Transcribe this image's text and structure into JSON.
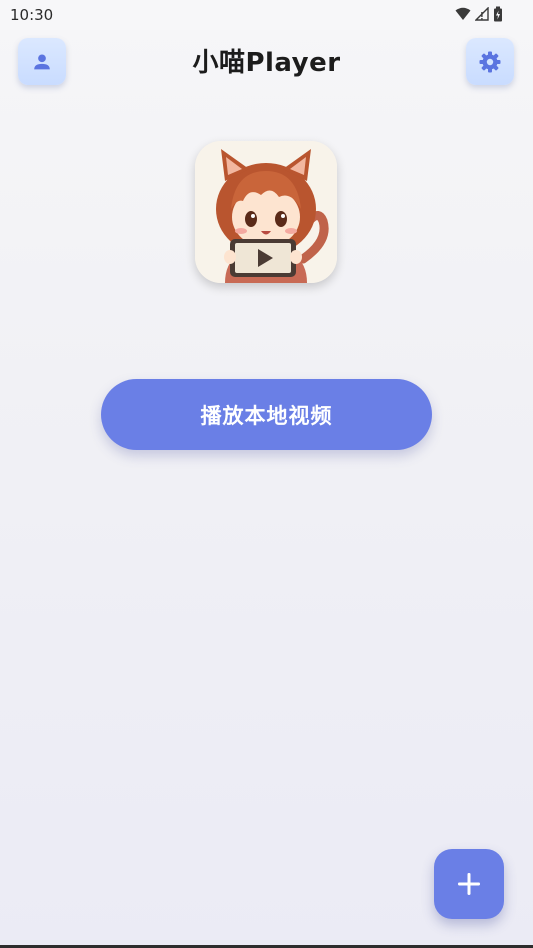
{
  "status_bar": {
    "time": "10:30",
    "icons": [
      "wifi-icon",
      "signal-icon",
      "battery-icon"
    ]
  },
  "header": {
    "title": "小喵Player",
    "left_button_icon": "person-icon",
    "right_button_icon": "gear-icon"
  },
  "main": {
    "avatar_icon": "cat-girl-video-avatar",
    "play_local_button_label": "播放本地视频"
  },
  "fab": {
    "icon": "plus-icon"
  },
  "colors": {
    "accent": "#6a7fe6",
    "header_button_bg": "#d4e4ff",
    "icon_blue": "#5b74e0"
  }
}
